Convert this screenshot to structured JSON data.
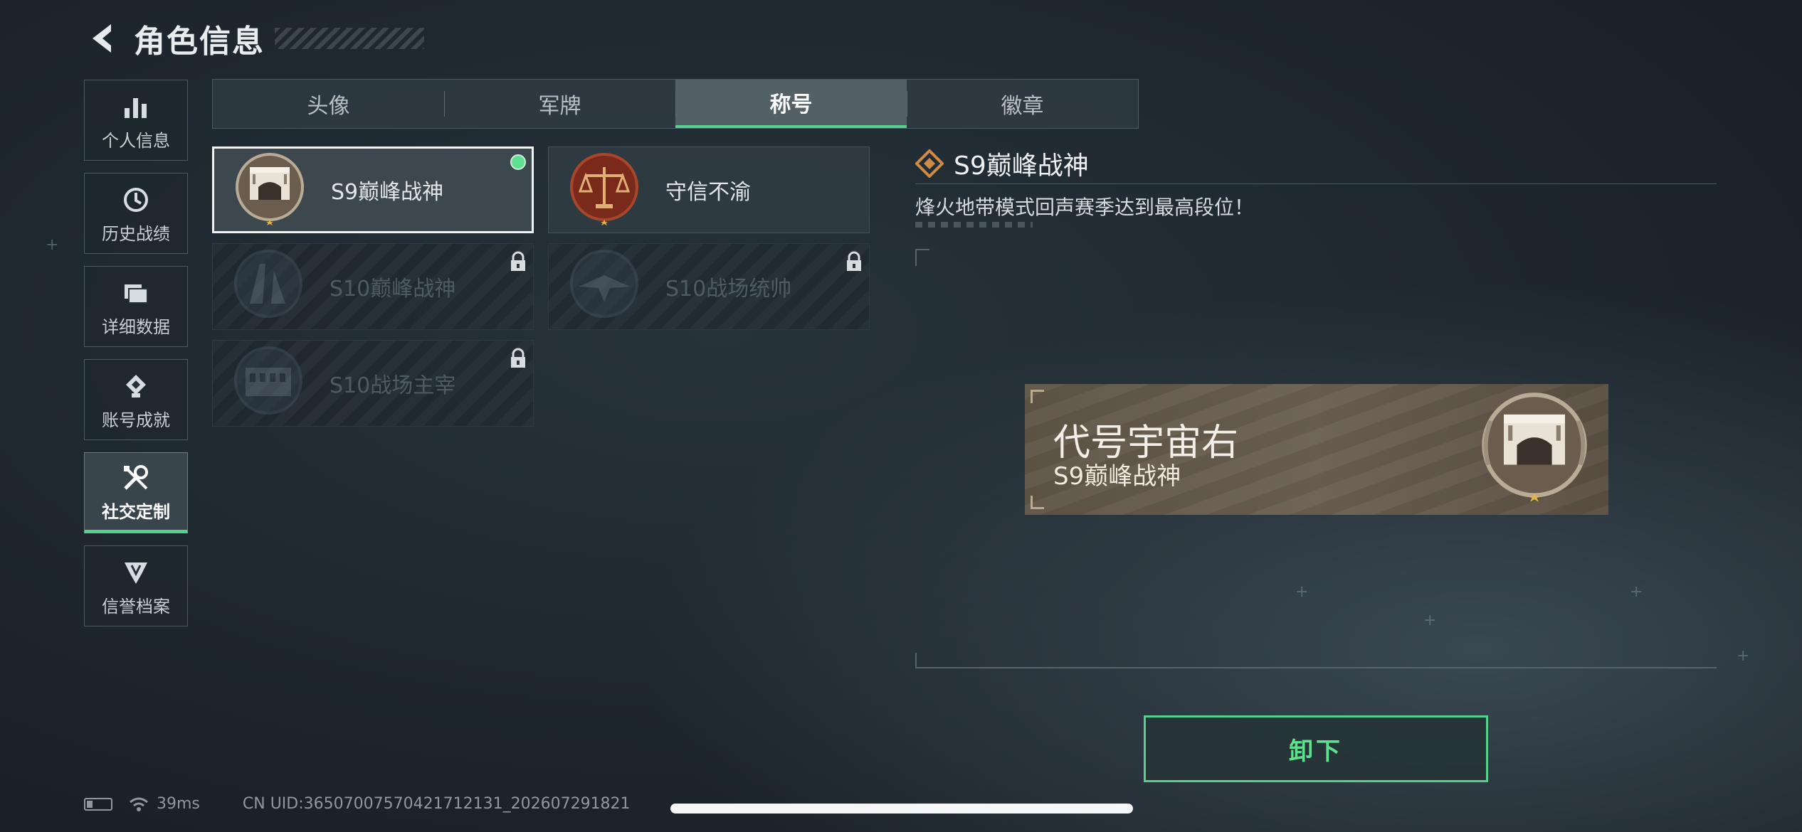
{
  "header": {
    "title": "角色信息"
  },
  "sidebar": {
    "items": [
      {
        "label": "个人信息",
        "icon": "bar-chart-icon"
      },
      {
        "label": "历史战绩",
        "icon": "clock-icon"
      },
      {
        "label": "详细数据",
        "icon": "folder-icon"
      },
      {
        "label": "账号成就",
        "icon": "achievement-badge-icon"
      },
      {
        "label": "社交定制",
        "icon": "tools-icon",
        "active": true
      },
      {
        "label": "信誉档案",
        "icon": "shield-emblem-icon"
      }
    ]
  },
  "tabs": [
    {
      "label": "头像"
    },
    {
      "label": "军牌"
    },
    {
      "label": "称号",
      "active": true
    },
    {
      "label": "徽章"
    }
  ],
  "titles": [
    {
      "name": "S9巅峰战神",
      "state": "equipped"
    },
    {
      "name": "守信不渝",
      "state": "owned"
    },
    {
      "name": "S10巅峰战神",
      "state": "locked"
    },
    {
      "name": "S10战场统帅",
      "state": "locked"
    },
    {
      "name": "S10战场主宰",
      "state": "locked"
    }
  ],
  "detail": {
    "name": "S9巅峰战神",
    "description": "烽火地带模式回声赛季达到最高段位！"
  },
  "preview": {
    "player_name": "代号宇宙右",
    "title": "S9巅峰战神"
  },
  "unequip_label": "卸下",
  "status": {
    "ping": "39ms",
    "uid": "CN UID:36507007570421712131_202607291821"
  },
  "colors": {
    "accent_green": "#56d08d",
    "plate_brown": "#665b4c",
    "scale_red": "#7a2a1a"
  }
}
